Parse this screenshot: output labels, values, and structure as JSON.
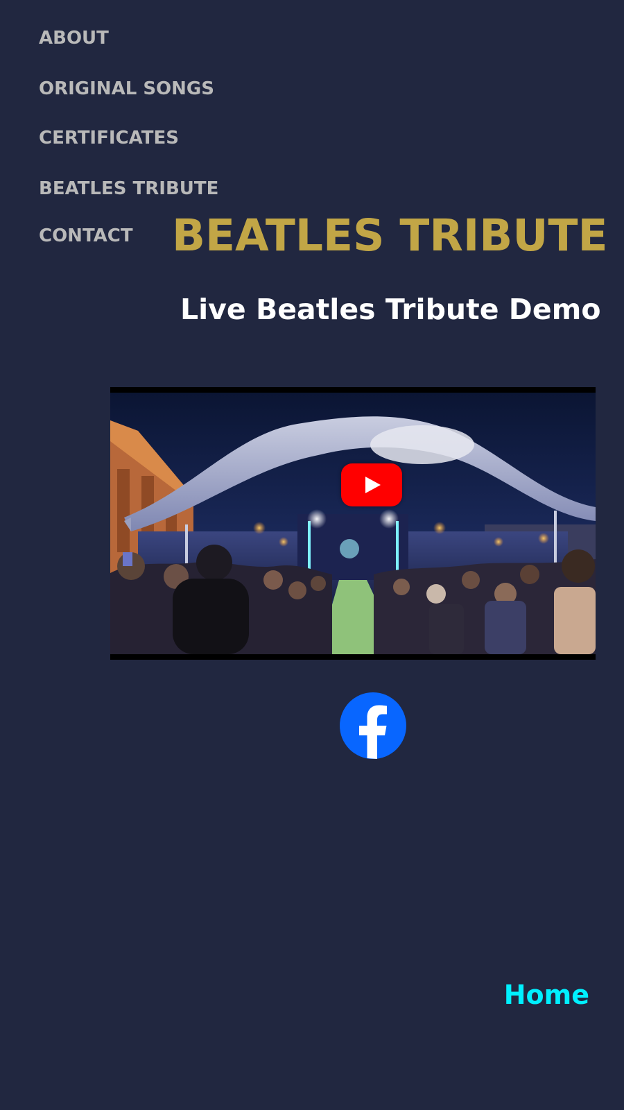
{
  "nav": {
    "items": [
      {
        "label": "ABOUT"
      },
      {
        "label": "ORIGINAL SONGS"
      },
      {
        "label": "CERTIFICATES"
      },
      {
        "label": "BEATLES TRIBUTE"
      },
      {
        "label": "CONTACT"
      }
    ]
  },
  "main": {
    "title": "BEATLES TRIBUTE",
    "subtitle": "Live Beatles Tribute Demo"
  },
  "video": {
    "play_icon": "youtube-play-icon",
    "play_button_color": "#ff0000"
  },
  "social": {
    "facebook_icon": "facebook-icon",
    "facebook_color": "#0866ff"
  },
  "footer": {
    "home_label": "Home"
  },
  "colors": {
    "background": "#212740",
    "nav_text": "#b9b9b9",
    "title": "#c2a646",
    "subtitle": "#ffffff",
    "home_link": "#00f0ff"
  }
}
